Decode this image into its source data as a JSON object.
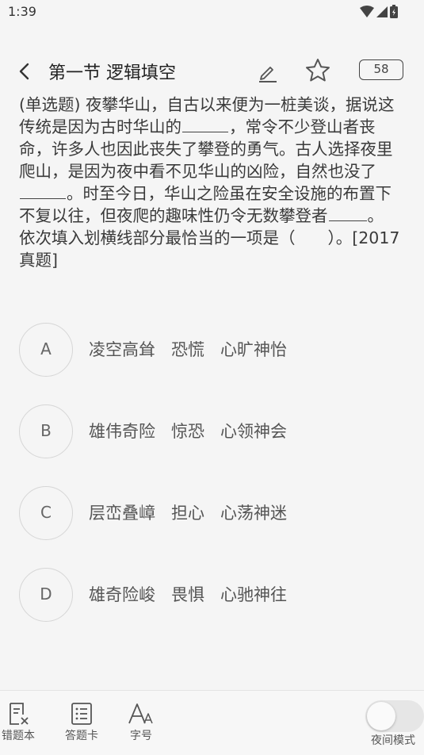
{
  "status_bar": {
    "time": "1:39"
  },
  "toolbar": {
    "title": "第一节 逻辑填空",
    "question_count": "58",
    "icons": [
      "back-arrow-icon",
      "pencil-icon",
      "star-icon"
    ]
  },
  "question": {
    "seg1": "(单选题) 夜攀华山，自古以来便为一桩美谈，据说这传统是因为古时华山的",
    "seg2": "，常令不少登山者丧命，许多人也因此丧失了攀登的勇气。古人选择夜里爬山，是因为夜中看不见华山的凶险，自然也没了",
    "seg3": "。时至今日，华山之险虽在安全设施的布置下不复以往，但夜爬的趣味性仍令无数攀登者",
    "seg4": "。",
    "prompt": "依次填入划横线部分最恰当的一项是（　　）。[2017真题]"
  },
  "options": [
    {
      "letter": "A",
      "text": "凌空高耸   恐慌   心旷神怡"
    },
    {
      "letter": "B",
      "text": "雄伟奇险   惊恐   心领神会"
    },
    {
      "letter": "C",
      "text": "层峦叠嶂   担心   心荡神迷"
    },
    {
      "letter": "D",
      "text": "雄奇险峻   畏惧   心驰神往"
    }
  ],
  "bottom_bar": {
    "wrong_book": "错题本",
    "answer_card": "答题卡",
    "font_size": "字号",
    "night_mode": "夜间模式",
    "night_mode_on": false
  }
}
